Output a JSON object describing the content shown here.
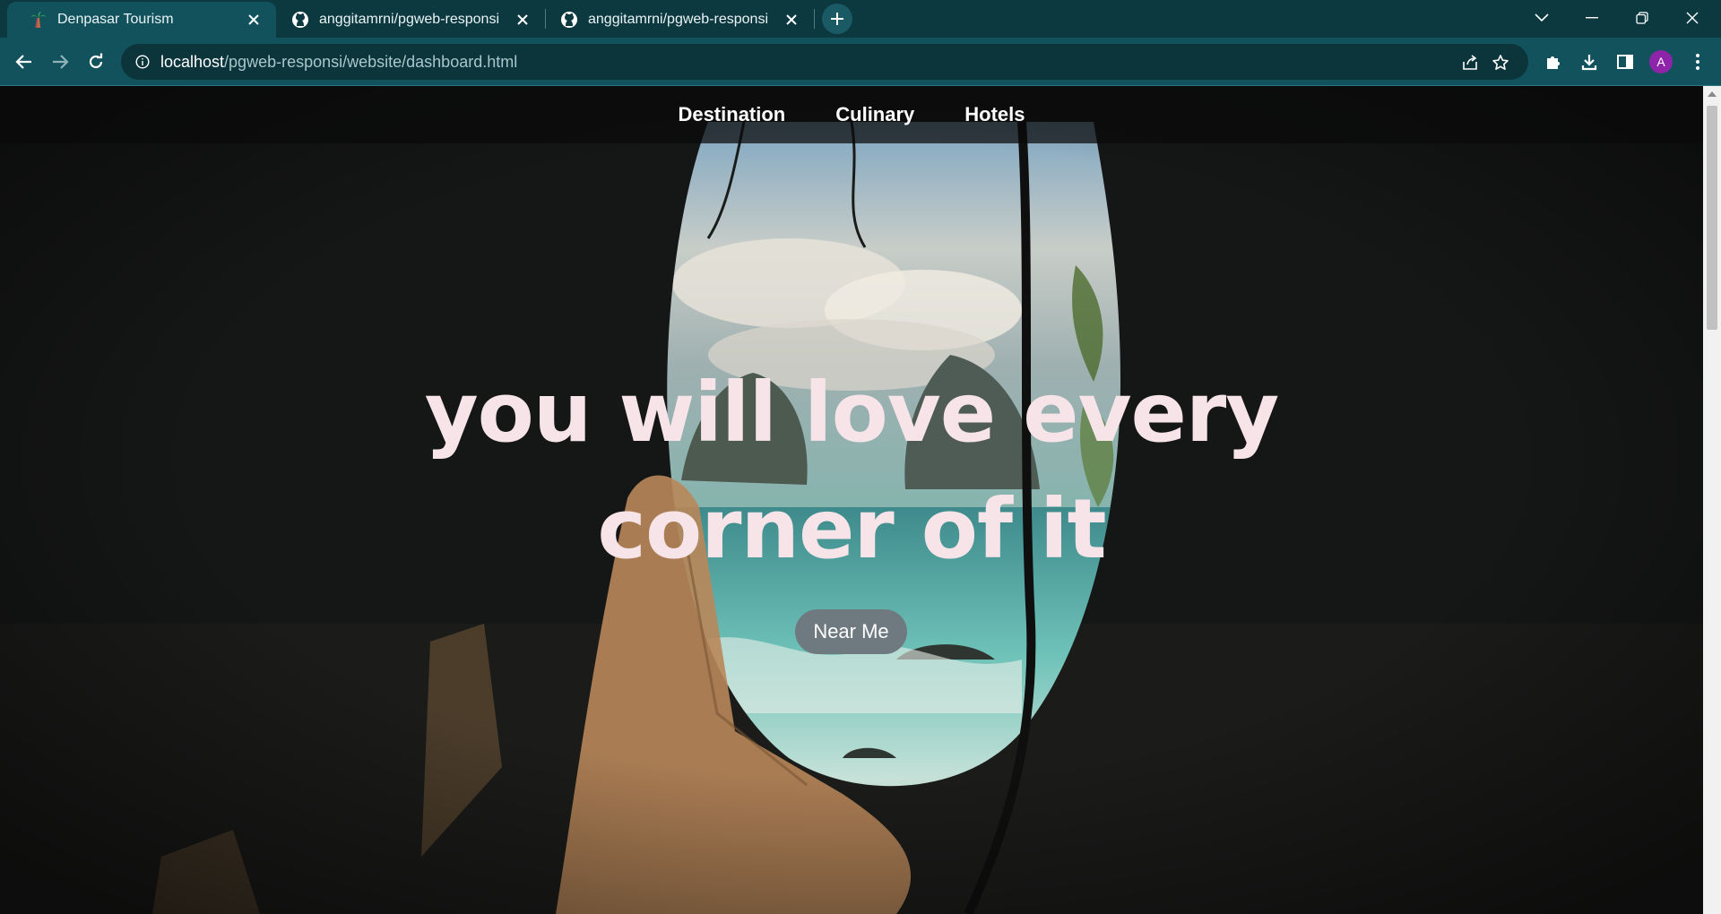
{
  "browser": {
    "tabs": [
      {
        "title": "Denpasar Tourism",
        "icon": "palm-tree-icon",
        "active": true
      },
      {
        "title": "anggitamrni/pgweb-responsi",
        "icon": "github-icon",
        "active": false
      },
      {
        "title": "anggitamrni/pgweb-responsi",
        "icon": "github-icon",
        "active": false
      }
    ],
    "url": {
      "host": "localhost",
      "path": "/pgweb-responsi/website/dashboard.html"
    },
    "profile_initial": "A",
    "colors": {
      "tabstrip": "#0c3840",
      "toolbar": "#11525d",
      "omnibox": "#0b343b",
      "avatar": "#8e24aa"
    }
  },
  "site": {
    "nav": [
      "Destination",
      "Culinary",
      "Hotels"
    ],
    "hero": {
      "line1": "you will love every",
      "line2": "corner of it"
    },
    "cta_label": "Near Me",
    "colors": {
      "hero_text": "#f7e4e8",
      "cta_bg": "#6e7a80"
    }
  }
}
